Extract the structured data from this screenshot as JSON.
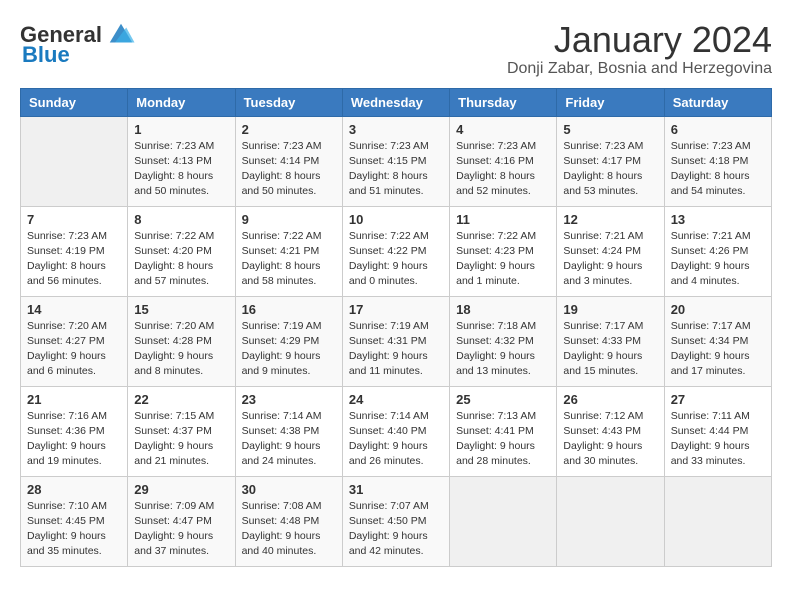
{
  "header": {
    "logo_general": "General",
    "logo_blue": "Blue",
    "month": "January 2024",
    "location": "Donji Zabar, Bosnia and Herzegovina"
  },
  "weekdays": [
    "Sunday",
    "Monday",
    "Tuesday",
    "Wednesday",
    "Thursday",
    "Friday",
    "Saturday"
  ],
  "weeks": [
    [
      {
        "day": "",
        "info": ""
      },
      {
        "day": "1",
        "info": "Sunrise: 7:23 AM\nSunset: 4:13 PM\nDaylight: 8 hours\nand 50 minutes."
      },
      {
        "day": "2",
        "info": "Sunrise: 7:23 AM\nSunset: 4:14 PM\nDaylight: 8 hours\nand 50 minutes."
      },
      {
        "day": "3",
        "info": "Sunrise: 7:23 AM\nSunset: 4:15 PM\nDaylight: 8 hours\nand 51 minutes."
      },
      {
        "day": "4",
        "info": "Sunrise: 7:23 AM\nSunset: 4:16 PM\nDaylight: 8 hours\nand 52 minutes."
      },
      {
        "day": "5",
        "info": "Sunrise: 7:23 AM\nSunset: 4:17 PM\nDaylight: 8 hours\nand 53 minutes."
      },
      {
        "day": "6",
        "info": "Sunrise: 7:23 AM\nSunset: 4:18 PM\nDaylight: 8 hours\nand 54 minutes."
      }
    ],
    [
      {
        "day": "7",
        "info": "Sunrise: 7:23 AM\nSunset: 4:19 PM\nDaylight: 8 hours\nand 56 minutes."
      },
      {
        "day": "8",
        "info": "Sunrise: 7:22 AM\nSunset: 4:20 PM\nDaylight: 8 hours\nand 57 minutes."
      },
      {
        "day": "9",
        "info": "Sunrise: 7:22 AM\nSunset: 4:21 PM\nDaylight: 8 hours\nand 58 minutes."
      },
      {
        "day": "10",
        "info": "Sunrise: 7:22 AM\nSunset: 4:22 PM\nDaylight: 9 hours\nand 0 minutes."
      },
      {
        "day": "11",
        "info": "Sunrise: 7:22 AM\nSunset: 4:23 PM\nDaylight: 9 hours\nand 1 minute."
      },
      {
        "day": "12",
        "info": "Sunrise: 7:21 AM\nSunset: 4:24 PM\nDaylight: 9 hours\nand 3 minutes."
      },
      {
        "day": "13",
        "info": "Sunrise: 7:21 AM\nSunset: 4:26 PM\nDaylight: 9 hours\nand 4 minutes."
      }
    ],
    [
      {
        "day": "14",
        "info": "Sunrise: 7:20 AM\nSunset: 4:27 PM\nDaylight: 9 hours\nand 6 minutes."
      },
      {
        "day": "15",
        "info": "Sunrise: 7:20 AM\nSunset: 4:28 PM\nDaylight: 9 hours\nand 8 minutes."
      },
      {
        "day": "16",
        "info": "Sunrise: 7:19 AM\nSunset: 4:29 PM\nDaylight: 9 hours\nand 9 minutes."
      },
      {
        "day": "17",
        "info": "Sunrise: 7:19 AM\nSunset: 4:31 PM\nDaylight: 9 hours\nand 11 minutes."
      },
      {
        "day": "18",
        "info": "Sunrise: 7:18 AM\nSunset: 4:32 PM\nDaylight: 9 hours\nand 13 minutes."
      },
      {
        "day": "19",
        "info": "Sunrise: 7:17 AM\nSunset: 4:33 PM\nDaylight: 9 hours\nand 15 minutes."
      },
      {
        "day": "20",
        "info": "Sunrise: 7:17 AM\nSunset: 4:34 PM\nDaylight: 9 hours\nand 17 minutes."
      }
    ],
    [
      {
        "day": "21",
        "info": "Sunrise: 7:16 AM\nSunset: 4:36 PM\nDaylight: 9 hours\nand 19 minutes."
      },
      {
        "day": "22",
        "info": "Sunrise: 7:15 AM\nSunset: 4:37 PM\nDaylight: 9 hours\nand 21 minutes."
      },
      {
        "day": "23",
        "info": "Sunrise: 7:14 AM\nSunset: 4:38 PM\nDaylight: 9 hours\nand 24 minutes."
      },
      {
        "day": "24",
        "info": "Sunrise: 7:14 AM\nSunset: 4:40 PM\nDaylight: 9 hours\nand 26 minutes."
      },
      {
        "day": "25",
        "info": "Sunrise: 7:13 AM\nSunset: 4:41 PM\nDaylight: 9 hours\nand 28 minutes."
      },
      {
        "day": "26",
        "info": "Sunrise: 7:12 AM\nSunset: 4:43 PM\nDaylight: 9 hours\nand 30 minutes."
      },
      {
        "day": "27",
        "info": "Sunrise: 7:11 AM\nSunset: 4:44 PM\nDaylight: 9 hours\nand 33 minutes."
      }
    ],
    [
      {
        "day": "28",
        "info": "Sunrise: 7:10 AM\nSunset: 4:45 PM\nDaylight: 9 hours\nand 35 minutes."
      },
      {
        "day": "29",
        "info": "Sunrise: 7:09 AM\nSunset: 4:47 PM\nDaylight: 9 hours\nand 37 minutes."
      },
      {
        "day": "30",
        "info": "Sunrise: 7:08 AM\nSunset: 4:48 PM\nDaylight: 9 hours\nand 40 minutes."
      },
      {
        "day": "31",
        "info": "Sunrise: 7:07 AM\nSunset: 4:50 PM\nDaylight: 9 hours\nand 42 minutes."
      },
      {
        "day": "",
        "info": ""
      },
      {
        "day": "",
        "info": ""
      },
      {
        "day": "",
        "info": ""
      }
    ]
  ]
}
